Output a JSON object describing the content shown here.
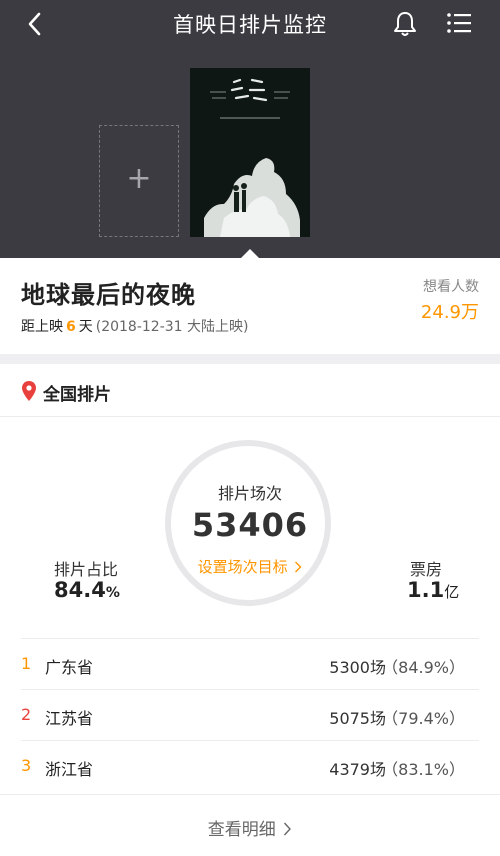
{
  "header": {
    "title": "首映日排片监控",
    "icons": {
      "back": "chevron-left-icon",
      "notify": "bell-icon",
      "menu": "list-menu-icon"
    },
    "add_poster_symbol": "+"
  },
  "movie": {
    "title": "地球最后的夜晚",
    "release_prefix": "距上映",
    "days_left": "6",
    "days_unit": "天",
    "release_note": "(2018-12-31 大陆上映)",
    "want_label": "想看人数",
    "want_count": "24.9万"
  },
  "region": {
    "label": "全国排片"
  },
  "summary": {
    "screenings_label": "排片场次",
    "screenings_value": "53406",
    "goal_link": "设置场次目标",
    "share_label": "排片占比",
    "share_value": "84.4",
    "share_unit": "%",
    "boxoffice_label": "票房",
    "boxoffice_value": "1.1",
    "boxoffice_unit": "亿"
  },
  "ranking": [
    {
      "rank": "1",
      "province": "广东省",
      "shows": "5300场",
      "share": "（84.9%）"
    },
    {
      "rank": "2",
      "province": "江苏省",
      "shows": "5075场",
      "share": "（79.4%）"
    },
    {
      "rank": "3",
      "province": "浙江省",
      "shows": "4379场",
      "share": "（83.1%）"
    }
  ],
  "footer": {
    "detail_link": "查看明细"
  },
  "colors": {
    "header_bg": "#3c3b42",
    "accent": "#ff9600",
    "rank1": "#ff9600",
    "rank2": "#e8413d",
    "rank3": "#ff9600",
    "pin": "#e8413d"
  }
}
